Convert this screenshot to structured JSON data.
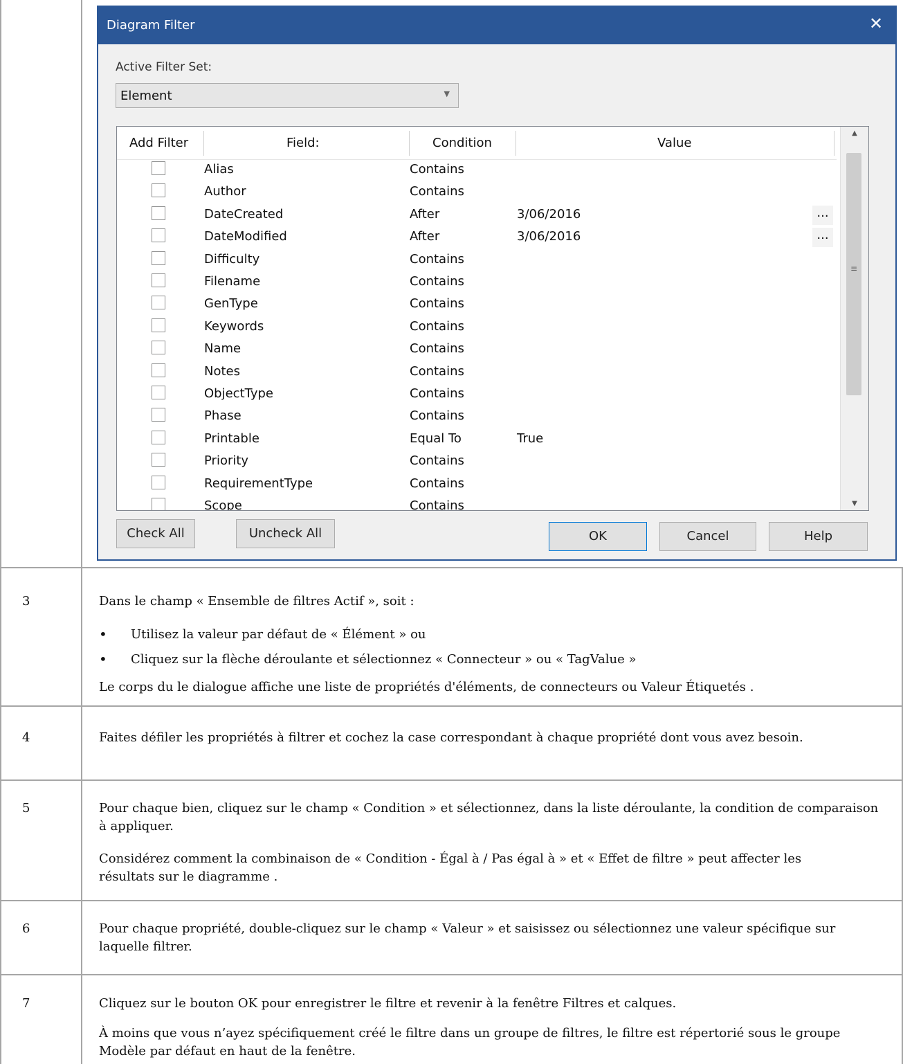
{
  "dialog": {
    "title": "Diagram Filter",
    "close_glyph": "✕",
    "active_filter_set_label": "Active Filter Set:",
    "active_filter_set_value": "Element",
    "columns": [
      "Add Filter",
      "Field:",
      "Condition",
      "Value"
    ],
    "rows": [
      {
        "field": "Alias",
        "condition": "Contains",
        "value": "",
        "has_browse": false
      },
      {
        "field": "Author",
        "condition": "Contains",
        "value": "",
        "has_browse": false
      },
      {
        "field": "DateCreated",
        "condition": "After",
        "value": "3/06/2016",
        "has_browse": true
      },
      {
        "field": "DateModified",
        "condition": "After",
        "value": "3/06/2016",
        "has_browse": true
      },
      {
        "field": "Difficulty",
        "condition": "Contains",
        "value": "",
        "has_browse": false
      },
      {
        "field": "Filename",
        "condition": "Contains",
        "value": "",
        "has_browse": false
      },
      {
        "field": "GenType",
        "condition": "Contains",
        "value": "",
        "has_browse": false
      },
      {
        "field": "Keywords",
        "condition": "Contains",
        "value": "",
        "has_browse": false
      },
      {
        "field": "Name",
        "condition": "Contains",
        "value": "",
        "has_browse": false
      },
      {
        "field": "Notes",
        "condition": "Contains",
        "value": "",
        "has_browse": false
      },
      {
        "field": "ObjectType",
        "condition": "Contains",
        "value": "",
        "has_browse": false
      },
      {
        "field": "Phase",
        "condition": "Contains",
        "value": "",
        "has_browse": false
      },
      {
        "field": "Printable",
        "condition": "Equal To",
        "value": "True",
        "has_browse": false
      },
      {
        "field": "Priority",
        "condition": "Contains",
        "value": "",
        "has_browse": false
      },
      {
        "field": "RequirementType",
        "condition": "Contains",
        "value": "",
        "has_browse": false
      },
      {
        "field": "Scope",
        "condition": "Contains",
        "value": "",
        "has_browse": false
      }
    ],
    "browse_label": "...",
    "buttons": {
      "check_all": "Check All",
      "uncheck_all": "Uncheck All",
      "ok": "OK",
      "cancel": "Cancel",
      "help": "Help"
    }
  },
  "steps": [
    {
      "number": "3",
      "intro": "Dans le champ « Ensemble de filtres Actif », soit :",
      "bullets": [
        "Utilisez la valeur par défaut de « Élément » ou",
        "Cliquez sur la flèche déroulante et sélectionnez « Connecteur » ou « TagValue »"
      ],
      "after": "Le corps du le dialogue affiche une liste de propriétés d'éléments, de connecteurs ou Valeur Étiquetés ."
    },
    {
      "number": "4",
      "text": "Faites défiler les propriétés à filtrer et cochez la case correspondant à chaque propriété dont vous avez besoin."
    },
    {
      "number": "5",
      "text": "Pour chaque bien, cliquez sur le champ « Condition » et sélectionnez, dans la liste déroulante, la condition de comparaison à appliquer.",
      "text2": "Considérez comment la combinaison de « Condition - Égal à / Pas égal à » et « Effet de filtre » peut affecter les résultats sur le diagramme ."
    },
    {
      "number": "6",
      "text": "Pour chaque propriété, double-cliquez sur le champ « Valeur » et saisissez ou sélectionnez une valeur spécifique sur laquelle filtrer."
    },
    {
      "number": "7",
      "text": "Cliquez sur le bouton OK pour enregistrer le filtre et revenir à la fenêtre Filtres et calques.",
      "text2": "À moins que vous n’ayez spécifiquement créé le filtre dans un groupe de filtres, le filtre est répertorié sous le groupe Modèle par défaut en haut de la fenêtre."
    }
  ]
}
